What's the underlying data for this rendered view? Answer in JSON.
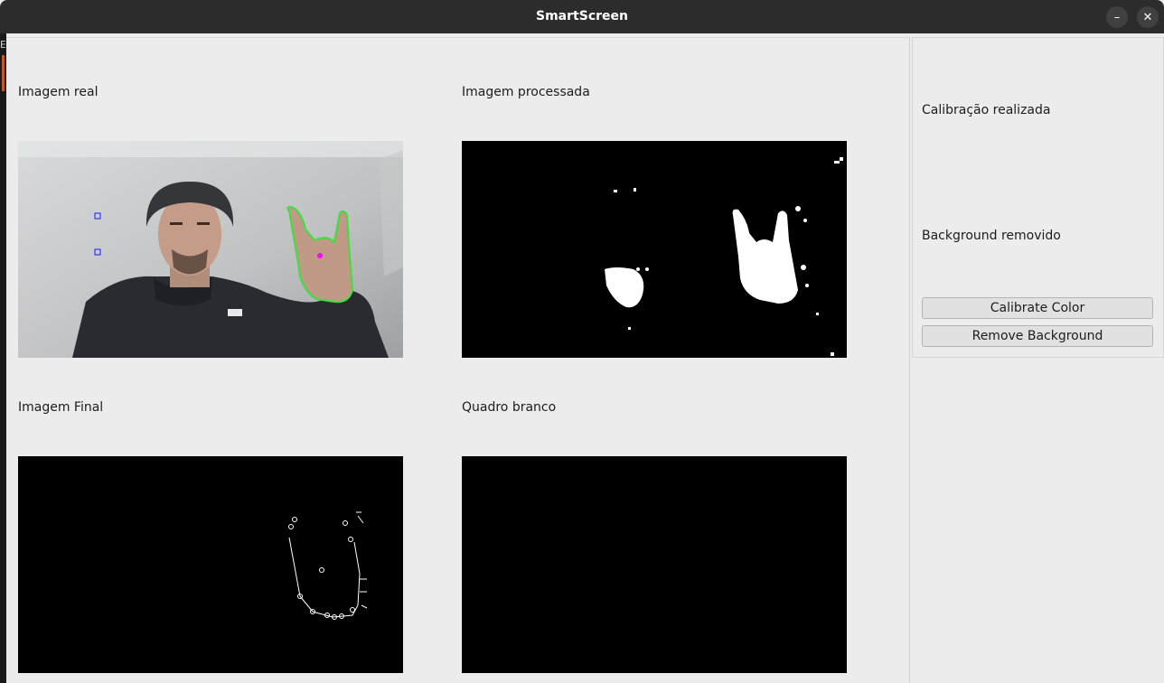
{
  "window": {
    "title": "SmartScreen",
    "minimize_glyph": "–",
    "close_glyph": "✕"
  },
  "background_app": {
    "visible_char": "E"
  },
  "panels": {
    "real": {
      "label": "Imagem real"
    },
    "processed": {
      "label": "Imagem processada"
    },
    "final": {
      "label": "Imagem Final"
    },
    "whiteboard": {
      "label": "Quadro branco"
    }
  },
  "sidebar": {
    "status_calibration": "Calibração realizada",
    "status_background": "Background removido",
    "calibrate_button": "Calibrate Color",
    "remove_bg_button": "Remove Background"
  },
  "colors": {
    "window_bg": "#ececec",
    "titlebar_bg": "#2c2c2c",
    "contour_green": "#3be03b",
    "marker_magenta": "#ff00ff",
    "marker_blue": "#1a1aff"
  }
}
